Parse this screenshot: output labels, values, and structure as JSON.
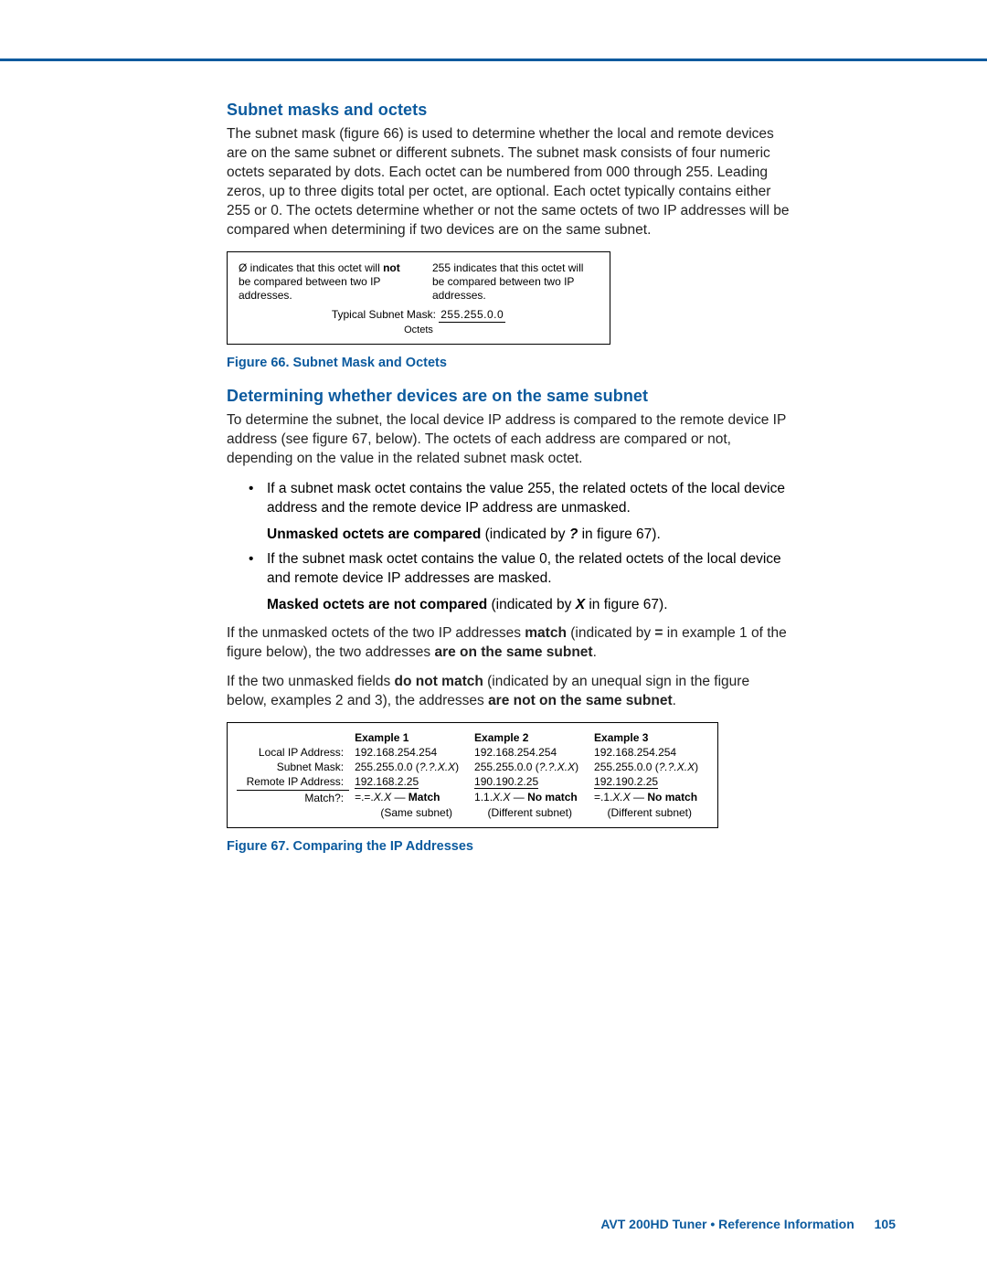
{
  "section1": {
    "heading": "Subnet masks and octets",
    "para": "The subnet mask (figure 66) is used to determine whether the local and remote devices are on the same subnet or different subnets. The subnet mask consists of four numeric octets separated by dots. Each octet can be numbered from 000 through 255. Leading zeros, up to three digits total per octet, are optional. Each octet typically contains either 255 or 0. The octets determine whether or not the same octets of two IP addresses will be compared when determining if two devices are on the same subnet."
  },
  "fig66": {
    "left_pre": "Ø indicates that this octet will ",
    "left_bold": "not",
    "left_post": " be compared between two IP addresses.",
    "right": "255 indicates that this octet will be compared between two IP addresses.",
    "mid_label": "Typical Subnet Mask: ",
    "mid_ip": "255.255.0.0",
    "octets": "Octets",
    "caption_label": "Figure 66.",
    "caption_text": "Subnet Mask and Octets"
  },
  "section2": {
    "heading": "Determining whether devices are on the same subnet",
    "para1": "To determine the subnet, the local device IP address is compared to the remote device IP address (see figure 67, below). The octets of each address are compared or not, depending on the value in the related subnet mask octet.",
    "bullet1": "If a subnet mask octet contains the value 255, the related octets of the local device address and the remote device IP address are unmasked.",
    "bullet1_sub_bold": "Unmasked octets are compared",
    "bullet1_sub_rest_a": " (indicated by ",
    "bullet1_sub_sym": "?",
    "bullet1_sub_rest_b": " in figure 67).",
    "bullet2": "If the subnet mask octet contains the value 0, the related octets of the local device and remote device IP addresses are masked.",
    "bullet2_sub_bold": "Masked octets are not compared",
    "bullet2_sub_rest_a": " (indicated by ",
    "bullet2_sub_sym": "X",
    "bullet2_sub_rest_b": " in figure 67).",
    "para2_a": "If the unmasked octets of the two IP addresses ",
    "para2_b": "match",
    "para2_c": " (indicated by ",
    "para2_d": "=",
    "para2_e": " in example 1 of the figure below), the two addresses ",
    "para2_f": "are on the same subnet",
    "para2_g": ".",
    "para3_a": "If the two unmasked fields ",
    "para3_b": "do not match",
    "para3_c": " (indicated by an unequal sign in the figure below, examples 2 and 3), the addresses ",
    "para3_d": "are not on the same subnet",
    "para3_e": "."
  },
  "fig67": {
    "headers": [
      "",
      "Example 1",
      "Example 2",
      "Example 3"
    ],
    "row_labels": [
      "Local IP Address:",
      "Subnet Mask:",
      "Remote IP Address:",
      "Match?:"
    ],
    "local": [
      "192.168.254.254",
      "192.168.254.254",
      "192.168.254.254"
    ],
    "mask_plain": "255.255.0.0 (",
    "mask_pattern": "?.?.X.X",
    "mask_close": ")",
    "remote": [
      "192.168.2.25",
      "190.190.2.25",
      "192.190.2.25"
    ],
    "match_sym": [
      "=.=.",
      "1.1.",
      "=.1."
    ],
    "match_xx": "X.X",
    "match_dash": " — ",
    "match_res": [
      "Match",
      "No match",
      "No match"
    ],
    "match_sub": [
      "(Same subnet)",
      "(Different subnet)",
      "(Different subnet)"
    ],
    "caption_label": "Figure 67.",
    "caption_text": "Comparing the IP Addresses"
  },
  "footer": {
    "text": "AVT 200HD Tuner • Reference Information",
    "page": "105"
  }
}
